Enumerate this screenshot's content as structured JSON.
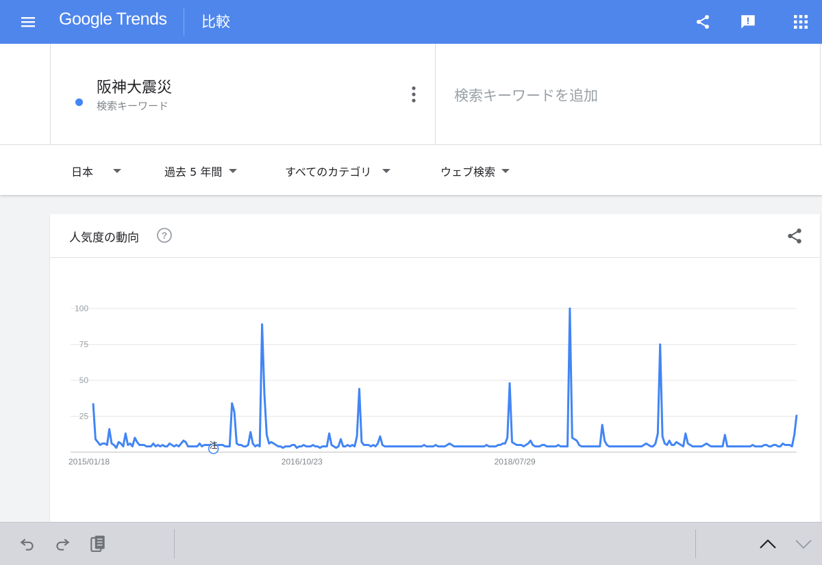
{
  "header": {
    "logo": "Google Trends",
    "page_title": "比較",
    "icons": [
      "menu-icon",
      "share-icon",
      "feedback-icon",
      "apps-grid-icon"
    ]
  },
  "search": {
    "term": "阪神大震災",
    "term_type": "検索キーワード",
    "term_color": "#4285f4",
    "add_placeholder": "検索キーワードを追加"
  },
  "filters": {
    "region": "日本",
    "period": "過去 5 年間",
    "category": "すべてのカテゴリ",
    "search_type": "ウェブ検索"
  },
  "card": {
    "title": "人気度の動向",
    "note_marker": "注"
  },
  "colors": {
    "header": "#4f86ec",
    "series": "#4285f4"
  },
  "chart_data": {
    "type": "line",
    "ylim": [
      0,
      100
    ],
    "yticks": [
      25,
      50,
      75,
      100
    ],
    "xtick_labels": [
      "2015/01/18",
      "2016/10/23",
      "2018/07/29"
    ],
    "grid": true,
    "series": [
      {
        "values": [
          34,
          9,
          7,
          5,
          6,
          6,
          5,
          16,
          6,
          5,
          3,
          7,
          6,
          4,
          13,
          5,
          6,
          4,
          10,
          7,
          5,
          5,
          5,
          4,
          4,
          4,
          6,
          4,
          5,
          4,
          5,
          4,
          4,
          6,
          5,
          4,
          5,
          4,
          6,
          8,
          7,
          4,
          4,
          4,
          4,
          4,
          6,
          4,
          5,
          5,
          5,
          4,
          4,
          4,
          5,
          5,
          5,
          4,
          4,
          4,
          34,
          28,
          6,
          5,
          5,
          4,
          4,
          5,
          14,
          6,
          4,
          5,
          4,
          89,
          40,
          12,
          6,
          7,
          6,
          5,
          4,
          4,
          3,
          4,
          4,
          4,
          5,
          5,
          3,
          4,
          4,
          5,
          4,
          4,
          4,
          5,
          4,
          4,
          3,
          4,
          4,
          4,
          13,
          5,
          4,
          3,
          4,
          9,
          4,
          4,
          5,
          4,
          5,
          4,
          11,
          44,
          7,
          5,
          5,
          5,
          4,
          5,
          4,
          6,
          11,
          5,
          4,
          4,
          4,
          4,
          4,
          4,
          4,
          4,
          4,
          4,
          4,
          4,
          4,
          4,
          4,
          4,
          4,
          5,
          4,
          4,
          4,
          4,
          5,
          4,
          4,
          4,
          4,
          5,
          6,
          5,
          4,
          4,
          4,
          4,
          4,
          4,
          4,
          4,
          4,
          4,
          4,
          4,
          4,
          4,
          5,
          4,
          4,
          4,
          4,
          5,
          5,
          6,
          6,
          10,
          48,
          7,
          6,
          5,
          5,
          5,
          4,
          5,
          6,
          8,
          5,
          4,
          4,
          4,
          5,
          5,
          4,
          4,
          4,
          4,
          4,
          5,
          4,
          4,
          4,
          4,
          100,
          10,
          9,
          8,
          5,
          4,
          4,
          4,
          4,
          4,
          4,
          4,
          4,
          4,
          19,
          8,
          5,
          4,
          4,
          4,
          4,
          4,
          4,
          4,
          4,
          4,
          4,
          4,
          4,
          4,
          4,
          4,
          5,
          6,
          5,
          4,
          4,
          6,
          13,
          75,
          11,
          6,
          5,
          8,
          5,
          5,
          7,
          6,
          5,
          4,
          13,
          6,
          5,
          4,
          4,
          4,
          4,
          4,
          5,
          6,
          5,
          4,
          4,
          4,
          4,
          4,
          4,
          12,
          4,
          4,
          4,
          4,
          4,
          4,
          4,
          4,
          4,
          4,
          4,
          5,
          4,
          4,
          4,
          4,
          5,
          5,
          4,
          4,
          5,
          5,
          4,
          4,
          6,
          5,
          5,
          5,
          4,
          12,
          26
        ]
      }
    ],
    "x_labels": [
      "2015/01/18",
      "2016/10/23",
      "2018/07/29"
    ],
    "x_label_positions_index": [
      0,
      92,
      184
    ]
  },
  "bottom_bar": {
    "icons": [
      "undo-icon",
      "redo-icon",
      "clipboard-icon",
      "chevron-up-icon",
      "chevron-down-icon"
    ]
  }
}
